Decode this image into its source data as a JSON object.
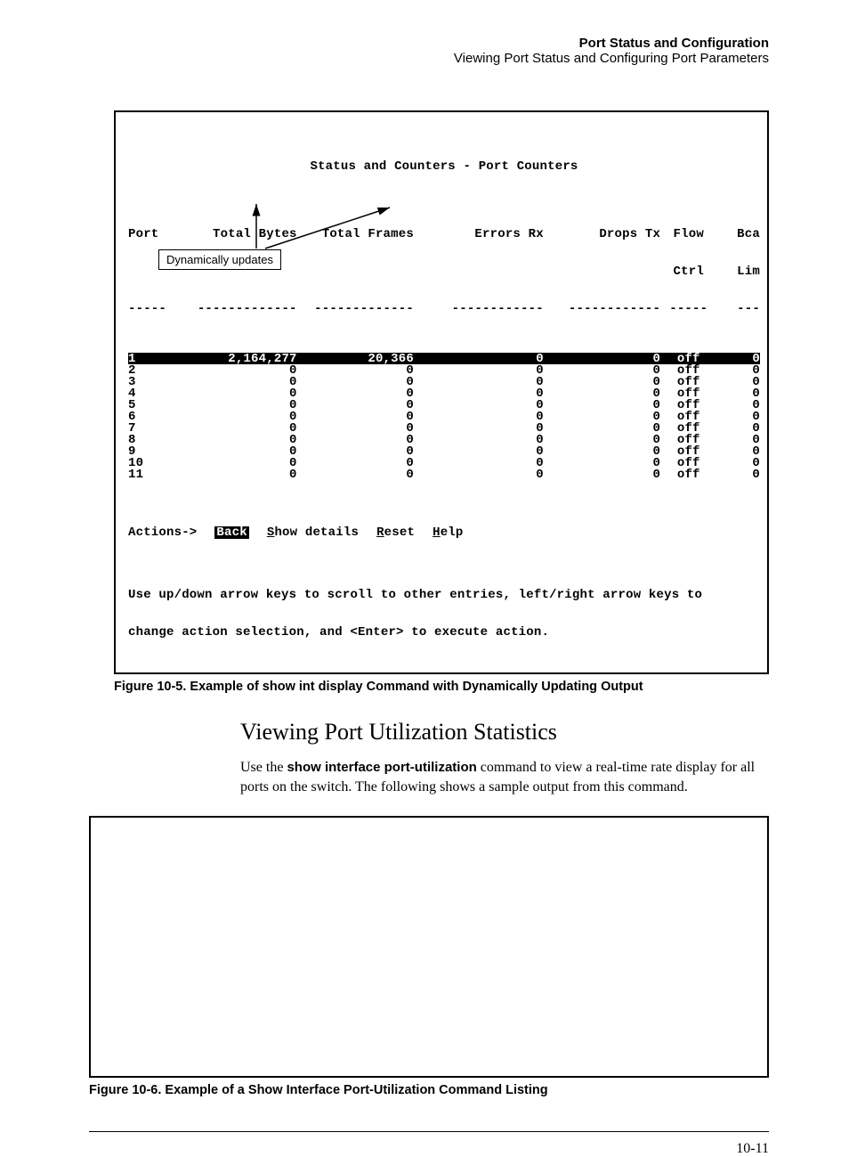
{
  "header": {
    "title": "Port Status and Configuration",
    "subtitle": "Viewing Port Status and Configuring Port Parameters"
  },
  "figure1": {
    "caption": "Figure 10-5.  Example of show int display Command with Dynamically Updating Output",
    "terminal": {
      "title": "Status and Counters - Port Counters",
      "cols": {
        "port": "Port",
        "bytes": "Total Bytes",
        "frames": "Total Frames",
        "errors": "Errors Rx",
        "drops": "Drops Tx",
        "flow1": "Flow",
        "flow2": "Ctrl",
        "lim1": "Bca",
        "lim2": "Lim"
      },
      "dash": {
        "port": "-----",
        "bytes": "-------------",
        "frames": "-------------",
        "errors": "------------",
        "drops": "------------",
        "flow": "-----",
        "lim": "---"
      },
      "rows": [
        {
          "port": "1",
          "bytes": "2,164,277",
          "frames": "20,366",
          "err": "0",
          "drops": "0",
          "flow": "off",
          "lim": "0",
          "hl": true
        },
        {
          "port": "2",
          "bytes": "0",
          "frames": "0",
          "err": "0",
          "drops": "0",
          "flow": "off",
          "lim": "0"
        },
        {
          "port": "3",
          "bytes": "0",
          "frames": "0",
          "err": "0",
          "drops": "0",
          "flow": "off",
          "lim": "0"
        },
        {
          "port": "4",
          "bytes": "0",
          "frames": "0",
          "err": "0",
          "drops": "0",
          "flow": "off",
          "lim": "0"
        },
        {
          "port": "5",
          "bytes": "0",
          "frames": "0",
          "err": "0",
          "drops": "0",
          "flow": "off",
          "lim": "0"
        },
        {
          "port": "6",
          "bytes": "0",
          "frames": "0",
          "err": "0",
          "drops": "0",
          "flow": "off",
          "lim": "0"
        },
        {
          "port": "7",
          "bytes": "0",
          "frames": "0",
          "err": "0",
          "drops": "0",
          "flow": "off",
          "lim": "0"
        },
        {
          "port": "8",
          "bytes": "0",
          "frames": "0",
          "err": "0",
          "drops": "0",
          "flow": "off",
          "lim": "0"
        },
        {
          "port": "9",
          "bytes": "0",
          "frames": "0",
          "err": "0",
          "drops": "0",
          "flow": "off",
          "lim": "0"
        },
        {
          "port": "10",
          "bytes": "0",
          "frames": "0",
          "err": "0",
          "drops": "0",
          "flow": "off",
          "lim": "0"
        },
        {
          "port": "11",
          "bytes": "0",
          "frames": "0",
          "err": "0",
          "drops": "0",
          "flow": "off",
          "lim": "0"
        }
      ],
      "actions": {
        "label": "Actions->",
        "back": "Back",
        "show": "how details",
        "show_u": "S",
        "reset": "eset",
        "reset_u": "R",
        "help": "elp",
        "help_u": "H"
      },
      "hint1": "Use up/down arrow keys to scroll to other entries, left/right arrow keys to",
      "hint2": "change action selection, and <Enter> to execute action."
    },
    "callout": "Dynamically updates"
  },
  "section": {
    "heading": "Viewing Port Utilization Statistics",
    "para_a": "Use the ",
    "para_cmd": "show interface port-utilization",
    "para_b": " command to view a real-time rate display for all ports on the switch. The following shows a sample output from this command."
  },
  "figure2": {
    "caption": "Figure 10-6.  Example of a Show Interface Port-Utilization Command Listing"
  },
  "pagenum": "10-11"
}
